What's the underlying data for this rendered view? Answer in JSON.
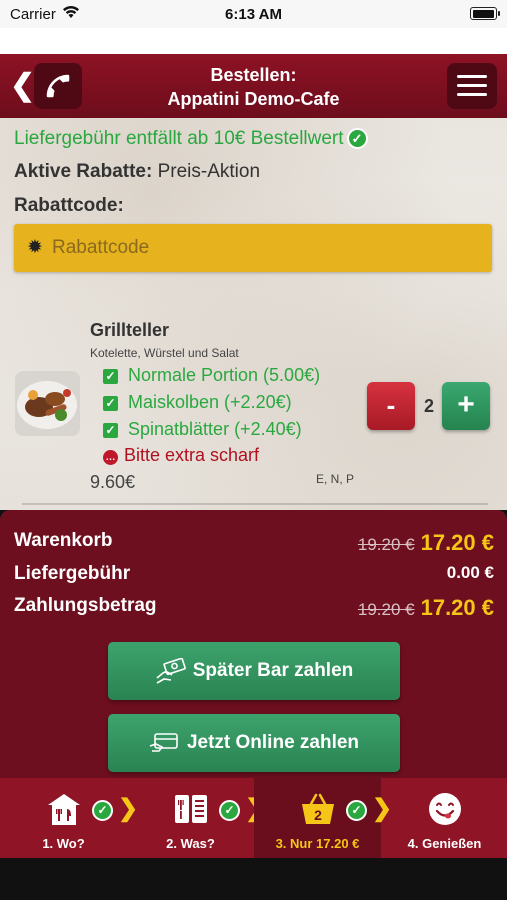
{
  "status": {
    "carrier": "Carrier",
    "time": "6:13 AM",
    "battery_level": 1.0
  },
  "header": {
    "title_line1": "Bestellen:",
    "title_line2": "Appatini Demo-Cafe"
  },
  "info": {
    "fee_notice": "Liefergebühr entfällt ab 10€ Bestellwert",
    "discount_label": "Aktive Rabatte:",
    "discount_value": "Preis-Aktion",
    "code_label": "Rabattcode:",
    "code_placeholder": "Rabattcode"
  },
  "item": {
    "name": "Grillteller",
    "description": "Kotelette, Würstel und Salat",
    "options": [
      "Normale Portion (5.00€)",
      "Maiskolben (+2.20€)",
      "Spinatblätter (+2.40€)"
    ],
    "note": "Bitte extra scharf",
    "price": "9.60€",
    "allergens": "E, N, P",
    "quantity": "2",
    "minus_label": "-",
    "plus_label": "+"
  },
  "summary": {
    "cart_label": "Warenkorb",
    "cart_old": "19.20 €",
    "cart_new": "17.20 €",
    "fee_label": "Liefergebühr",
    "fee_value": "0.00 €",
    "total_label": "Zahlungsbetrag",
    "total_old": "19.20 €",
    "total_new": "17.20 €"
  },
  "buttons": {
    "cash": "Später Bar zahlen",
    "online": "Jetzt Online zahlen"
  },
  "nav": {
    "steps": [
      {
        "label": "1. Wo?"
      },
      {
        "label": "2. Was?"
      },
      {
        "label": "3. Nur 17.20 €",
        "badge": "2"
      },
      {
        "label": "4. Genießen"
      }
    ]
  },
  "colors": {
    "brand": "#8f1425",
    "accent": "#f5c518",
    "green": "#2aa83f"
  }
}
